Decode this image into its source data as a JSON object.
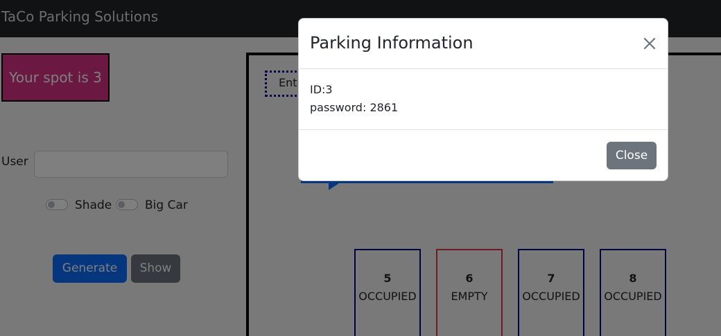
{
  "app": {
    "brand": "TaCo Parking Solutions"
  },
  "sidebar": {
    "spot_message": "Your spot is 3",
    "user_label": "User",
    "user_value": "",
    "toggles": [
      {
        "label": "Shade",
        "on": false
      },
      {
        "label": "Big Car",
        "on": false
      }
    ],
    "generate_label": "Generate",
    "show_label": "Show"
  },
  "lot": {
    "entrance_label": "Entrance",
    "spots": [
      {
        "number": "5",
        "status": "OCCUPIED"
      },
      {
        "number": "6",
        "status": "EMPTY"
      },
      {
        "number": "7",
        "status": "OCCUPIED"
      },
      {
        "number": "8",
        "status": "OCCUPIED"
      }
    ]
  },
  "modal": {
    "title": "Parking Information",
    "id_line": "ID:3",
    "password_line": "password: 2861",
    "close_label": "Close"
  },
  "colors": {
    "primary": "#0d6efd",
    "secondary": "#6c757d",
    "spot_highlight": "#d63384",
    "occupied_border": "#00008b",
    "empty_border": "#dc3545"
  }
}
